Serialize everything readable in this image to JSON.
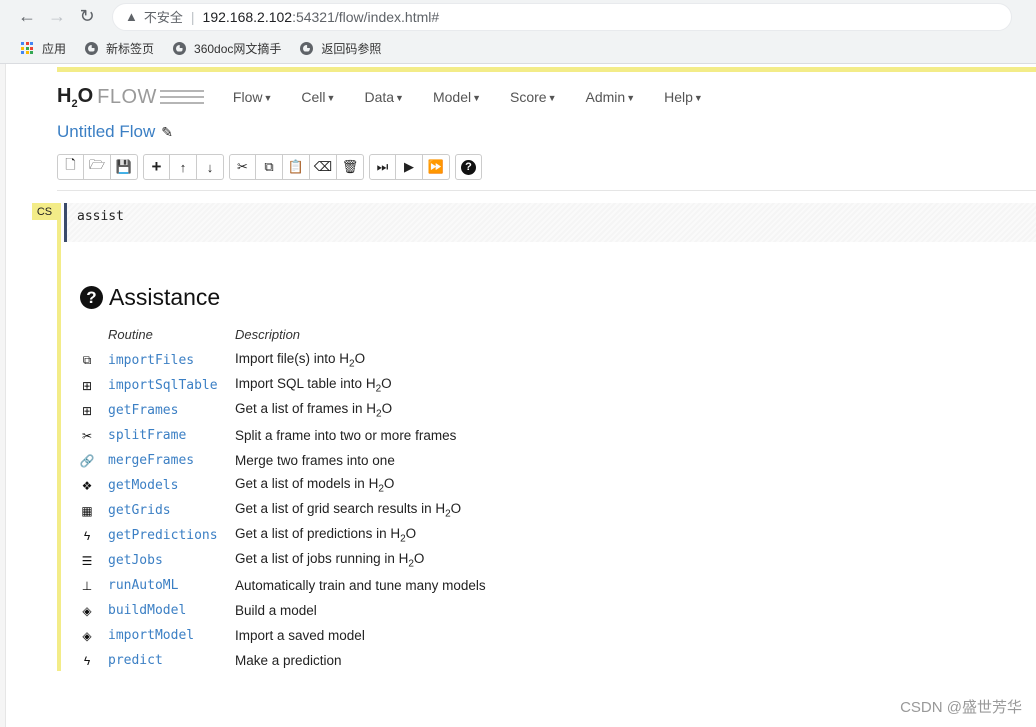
{
  "browser": {
    "security_label": "不安全",
    "url_host": "192.168.2.102",
    "url_rest": ":54321/flow/index.html#",
    "bookmarks": [
      "应用",
      "新标签页",
      "360doc网文摘手",
      "返回码参照"
    ]
  },
  "app": {
    "logo_text": "H2O",
    "logo_word": "FLOW",
    "menus": [
      "Flow",
      "Cell",
      "Data",
      "Model",
      "Score",
      "Admin",
      "Help"
    ],
    "flow_title": "Untitled Flow"
  },
  "cell": {
    "type_badge": "CS",
    "code": "assist"
  },
  "assistance": {
    "title": "Assistance",
    "headers": {
      "routine": "Routine",
      "description": "Description"
    },
    "rows": [
      {
        "icon": "files-icon",
        "glyph": "⧉",
        "routine": "importFiles",
        "description": "Import file(s) into H2O"
      },
      {
        "icon": "table-icon",
        "glyph": "⊞",
        "routine": "importSqlTable",
        "description": "Import SQL table into H2O"
      },
      {
        "icon": "table-icon",
        "glyph": "⊞",
        "routine": "getFrames",
        "description": "Get a list of frames in H2O"
      },
      {
        "icon": "scissors-icon",
        "glyph": "✂",
        "routine": "splitFrame",
        "description": "Split a frame into two or more frames"
      },
      {
        "icon": "link-icon",
        "glyph": "🔗",
        "routine": "mergeFrames",
        "description": "Merge two frames into one"
      },
      {
        "icon": "cubes-icon",
        "glyph": "❖",
        "routine": "getModels",
        "description": "Get a list of models in H2O"
      },
      {
        "icon": "grid-icon",
        "glyph": "▦",
        "routine": "getGrids",
        "description": "Get a list of grid search results in H2O"
      },
      {
        "icon": "bolt-icon",
        "glyph": "ϟ",
        "routine": "getPredictions",
        "description": "Get a list of predictions in H2O"
      },
      {
        "icon": "tasks-icon",
        "glyph": "☰",
        "routine": "getJobs",
        "description": "Get a list of jobs running in H2O"
      },
      {
        "icon": "sitemap-icon",
        "glyph": "⊥",
        "routine": "runAutoML",
        "description": "Automatically train and tune many models"
      },
      {
        "icon": "cube-icon",
        "glyph": "◈",
        "routine": "buildModel",
        "description": "Build a model"
      },
      {
        "icon": "cube-icon",
        "glyph": "◈",
        "routine": "importModel",
        "description": "Import a saved model"
      },
      {
        "icon": "bolt-icon",
        "glyph": "ϟ",
        "routine": "predict",
        "description": "Make a prediction"
      }
    ]
  },
  "watermark": "CSDN @盛世芳华"
}
